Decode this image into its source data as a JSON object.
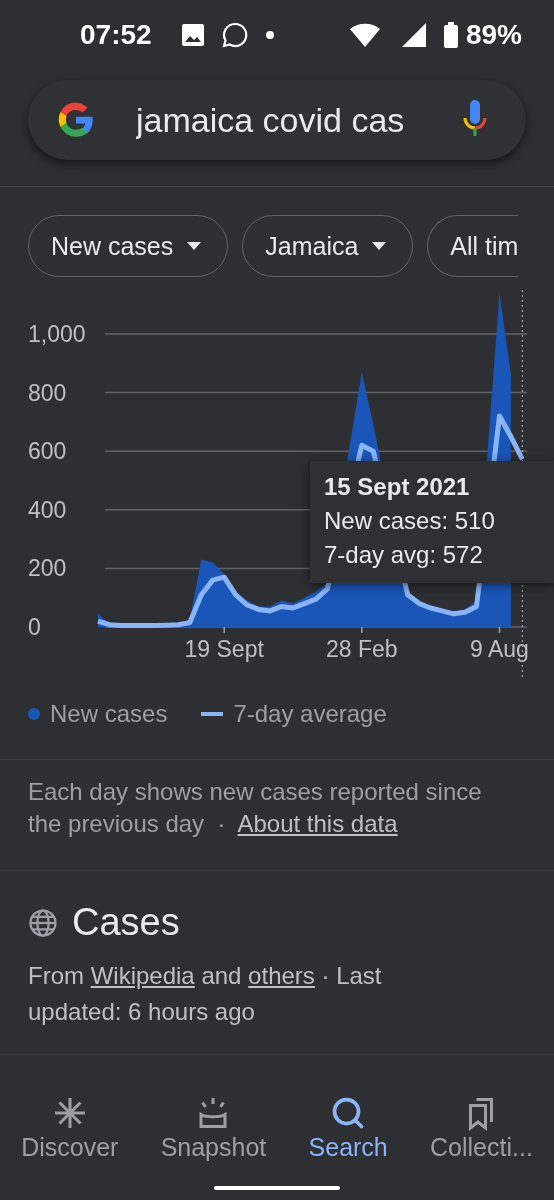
{
  "status_bar": {
    "time": "07:52",
    "battery": "89%"
  },
  "search": {
    "value": "jamaica covid cas"
  },
  "filters": [
    {
      "label": "New cases"
    },
    {
      "label": "Jamaica"
    },
    {
      "label": "All tim"
    }
  ],
  "chart": {
    "chart_data": {
      "type": "area",
      "categories": [
        null,
        null,
        null,
        null,
        null,
        null,
        null,
        null,
        null,
        null,
        null,
        "19 Sept",
        null,
        null,
        null,
        null,
        null,
        null,
        null,
        null,
        null,
        null,
        null,
        "28 Feb",
        null,
        null,
        null,
        null,
        null,
        null,
        null,
        null,
        null,
        null,
        null,
        "9 Aug",
        null,
        null
      ],
      "series": [
        {
          "name": "New cases",
          "type": "area",
          "color": "#1a56b8",
          "values": [
            45,
            10,
            5,
            5,
            5,
            6,
            8,
            12,
            25,
            230,
            220,
            180,
            120,
            90,
            70,
            70,
            90,
            80,
            100,
            120,
            150,
            null,
            null,
            870,
            690,
            null,
            null,
            120,
            90,
            70,
            60,
            50,
            60,
            90,
            null,
            1140,
            860,
            null
          ]
        },
        {
          "name": "7-day average",
          "type": "line",
          "color": "#8ab4f8",
          "values": [
            20,
            8,
            5,
            5,
            5,
            5,
            6,
            8,
            15,
            110,
            160,
            170,
            110,
            75,
            60,
            55,
            70,
            65,
            80,
            95,
            130,
            null,
            null,
            620,
            600,
            null,
            null,
            110,
            80,
            65,
            55,
            45,
            50,
            70,
            null,
            720,
            650,
            572
          ]
        }
      ],
      "grid": true,
      "ylim": [
        0,
        1150
      ],
      "yticks": [
        {
          "value": 0,
          "label": "0"
        },
        {
          "value": 200,
          "label": "200"
        },
        {
          "value": 400,
          "label": "400"
        },
        {
          "value": 600,
          "label": "600"
        },
        {
          "value": 800,
          "label": "800"
        },
        {
          "value": 1000,
          "label": "1,000"
        }
      ]
    },
    "tooltip": {
      "title": "15 Sept 2021",
      "lines": [
        "New cases: 510",
        "7-day avg: 572"
      ]
    }
  },
  "legend": [
    {
      "kind": "dot"
    },
    {
      "kind": "line"
    }
  ],
  "note": {
    "text": "Each day shows new cases reported since the previous day",
    "separator": "·",
    "link": "About this data"
  },
  "cases": {
    "title": "Cases",
    "source": [
      {
        "text": "From ",
        "link": false
      },
      {
        "text": "Wikipedia",
        "link": true
      },
      {
        "text": " and ",
        "link": false
      },
      {
        "text": "others",
        "link": true
      },
      {
        "text": " · Last updated: 6 hours ago",
        "link": false
      }
    ]
  },
  "nav": [
    {
      "label": "Discover",
      "kind": "discover",
      "selected": false
    },
    {
      "label": "Snapshot",
      "kind": "snapshot",
      "selected": false
    },
    {
      "label": "Search",
      "kind": "search",
      "selected": true
    },
    {
      "label": "Collecti...",
      "kind": "collections",
      "selected": false
    }
  ]
}
